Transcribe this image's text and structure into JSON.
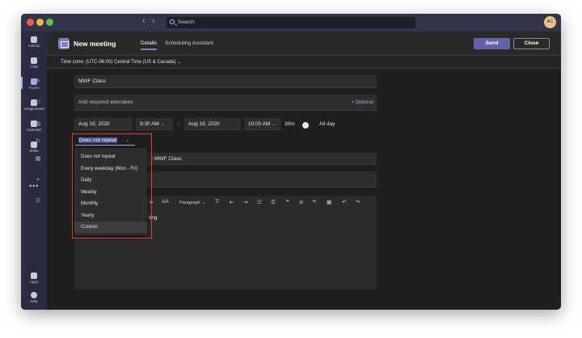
{
  "titlebar": {
    "back_arrow": "‹",
    "forward_arrow": "›",
    "search_placeholder": "Search",
    "avatar_initials": "AC"
  },
  "rail": {
    "items": [
      {
        "label": "Activity",
        "icon": "bell-icon"
      },
      {
        "label": "Chat",
        "icon": "chat-icon"
      },
      {
        "label": "Teams",
        "icon": "teams-icon",
        "active": true
      },
      {
        "label": "Assignments",
        "icon": "assignments-icon"
      },
      {
        "label": "Calendar",
        "icon": "calendar-icon"
      },
      {
        "label": "Shifts",
        "icon": "shifts-icon"
      }
    ],
    "more": "•••",
    "bottom": [
      {
        "label": "Apps",
        "icon": "apps-icon"
      },
      {
        "label": "Help",
        "icon": "help-icon"
      }
    ]
  },
  "header": {
    "title": "New meeting",
    "tabs": [
      "Details",
      "Scheduling Assistant"
    ],
    "active_tab": "Details",
    "send_label": "Send",
    "close_label": "Close"
  },
  "timezone": {
    "label": "Time zone: (UTC-06:00) Central Time (US & Canada)",
    "chevron": "⌄"
  },
  "form": {
    "title_value": "MWF Class",
    "attendees_placeholder": "Add required attendees",
    "optional_label": "+ Optional",
    "start_date": "Aug 19, 2020",
    "start_time": "9:30 AM",
    "end_date": "Aug 19, 2020",
    "end_time": "10:00 AM",
    "duration": "30m",
    "all_day_label": "All day",
    "repeat_value": "Does not repeat",
    "channel_value": "MWF Class",
    "details_partial": "ting"
  },
  "repeat_menu": {
    "options": [
      "Does not repeat",
      "Every weekday (Mon - Fri)",
      "Daily",
      "Weekly",
      "Monthly",
      "Yearly",
      "Custom"
    ],
    "hovered": "Custom"
  },
  "toolbar": {
    "font_size": "AA",
    "paragraph": "Paragraph",
    "quote": "❞"
  },
  "colors": {
    "accent": "#6264a7",
    "highlight": "#a6a7dc",
    "annotation": "#e23a2e"
  }
}
